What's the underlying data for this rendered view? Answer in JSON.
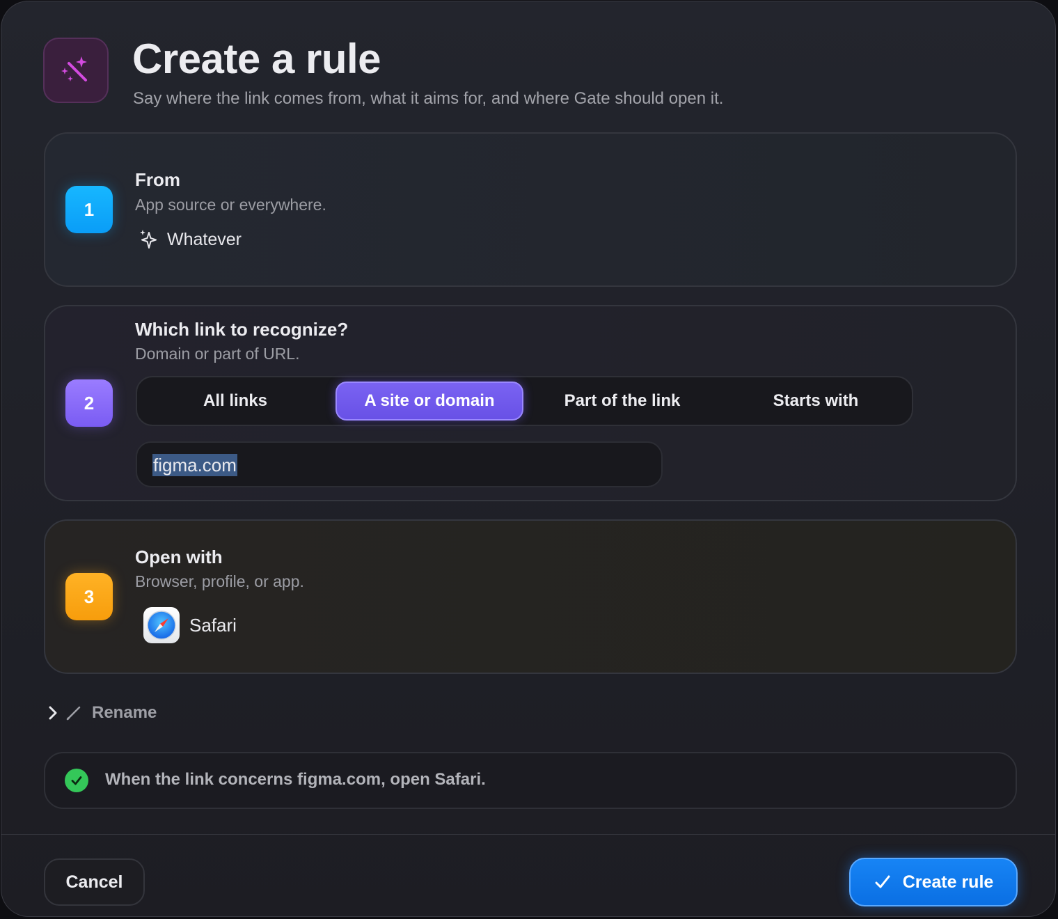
{
  "header": {
    "title": "Create a rule",
    "subtitle": "Say where the link comes from, what it aims for, and where Gate should open it.",
    "icon": "magic-wand-icon"
  },
  "steps": [
    {
      "number": "1",
      "title": "From",
      "subtitle": "App source or everywhere.",
      "value_icon": "sparkle-icon",
      "value": "Whatever",
      "color": "#0aa6ff"
    },
    {
      "number": "2",
      "title": "Which link to recognize?",
      "subtitle": "Domain or part of URL.",
      "color": "#8b6dfb",
      "modes": [
        "All links",
        "A site or domain",
        "Part of the link",
        "Starts with"
      ],
      "selected_mode": "A site or domain",
      "input_value": "figma.com"
    },
    {
      "number": "3",
      "title": "Open with",
      "subtitle": "Browser, profile, or app.",
      "value_icon": "safari-icon",
      "value": "Safari",
      "color": "#fba716"
    }
  ],
  "rename": {
    "label": "Rename"
  },
  "summary": {
    "text": "When the link concerns figma.com, open Safari.",
    "status_color": "#34c759"
  },
  "footer": {
    "cancel_label": "Cancel",
    "create_label": "Create rule",
    "accent": "#0a7cf0"
  }
}
